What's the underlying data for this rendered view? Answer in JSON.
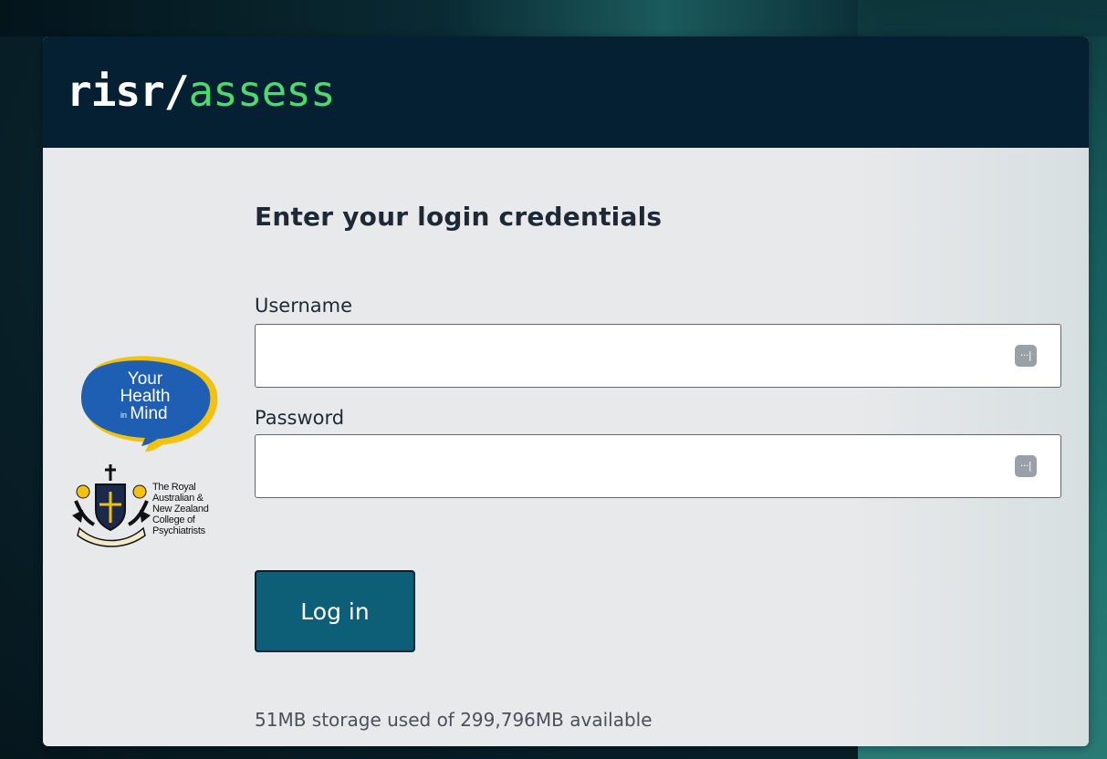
{
  "brand": {
    "part1": "risr/",
    "part2": "assess"
  },
  "logos": {
    "your_health_in_mind": {
      "line1": "Your",
      "line2": "Health",
      "line3_small": "in",
      "line3": "Mind"
    },
    "ranzcp": {
      "lines": [
        "The Royal",
        "Australian &",
        "New Zealand",
        "College of",
        "Psychiatrists"
      ]
    }
  },
  "login": {
    "heading": "Enter your login credentials",
    "username_label": "Username",
    "username_value": "",
    "password_label": "Password",
    "password_value": "",
    "button_label": "Log in"
  },
  "storage_text": "51MB storage used of 299,796MB available",
  "colors": {
    "header_bg": "#062033",
    "brand_accent": "#4fd86b",
    "button_bg": "#0d5f77",
    "card_bg": "#e8e9eb"
  },
  "icons": {
    "password_manager": "password-manager-icon"
  }
}
